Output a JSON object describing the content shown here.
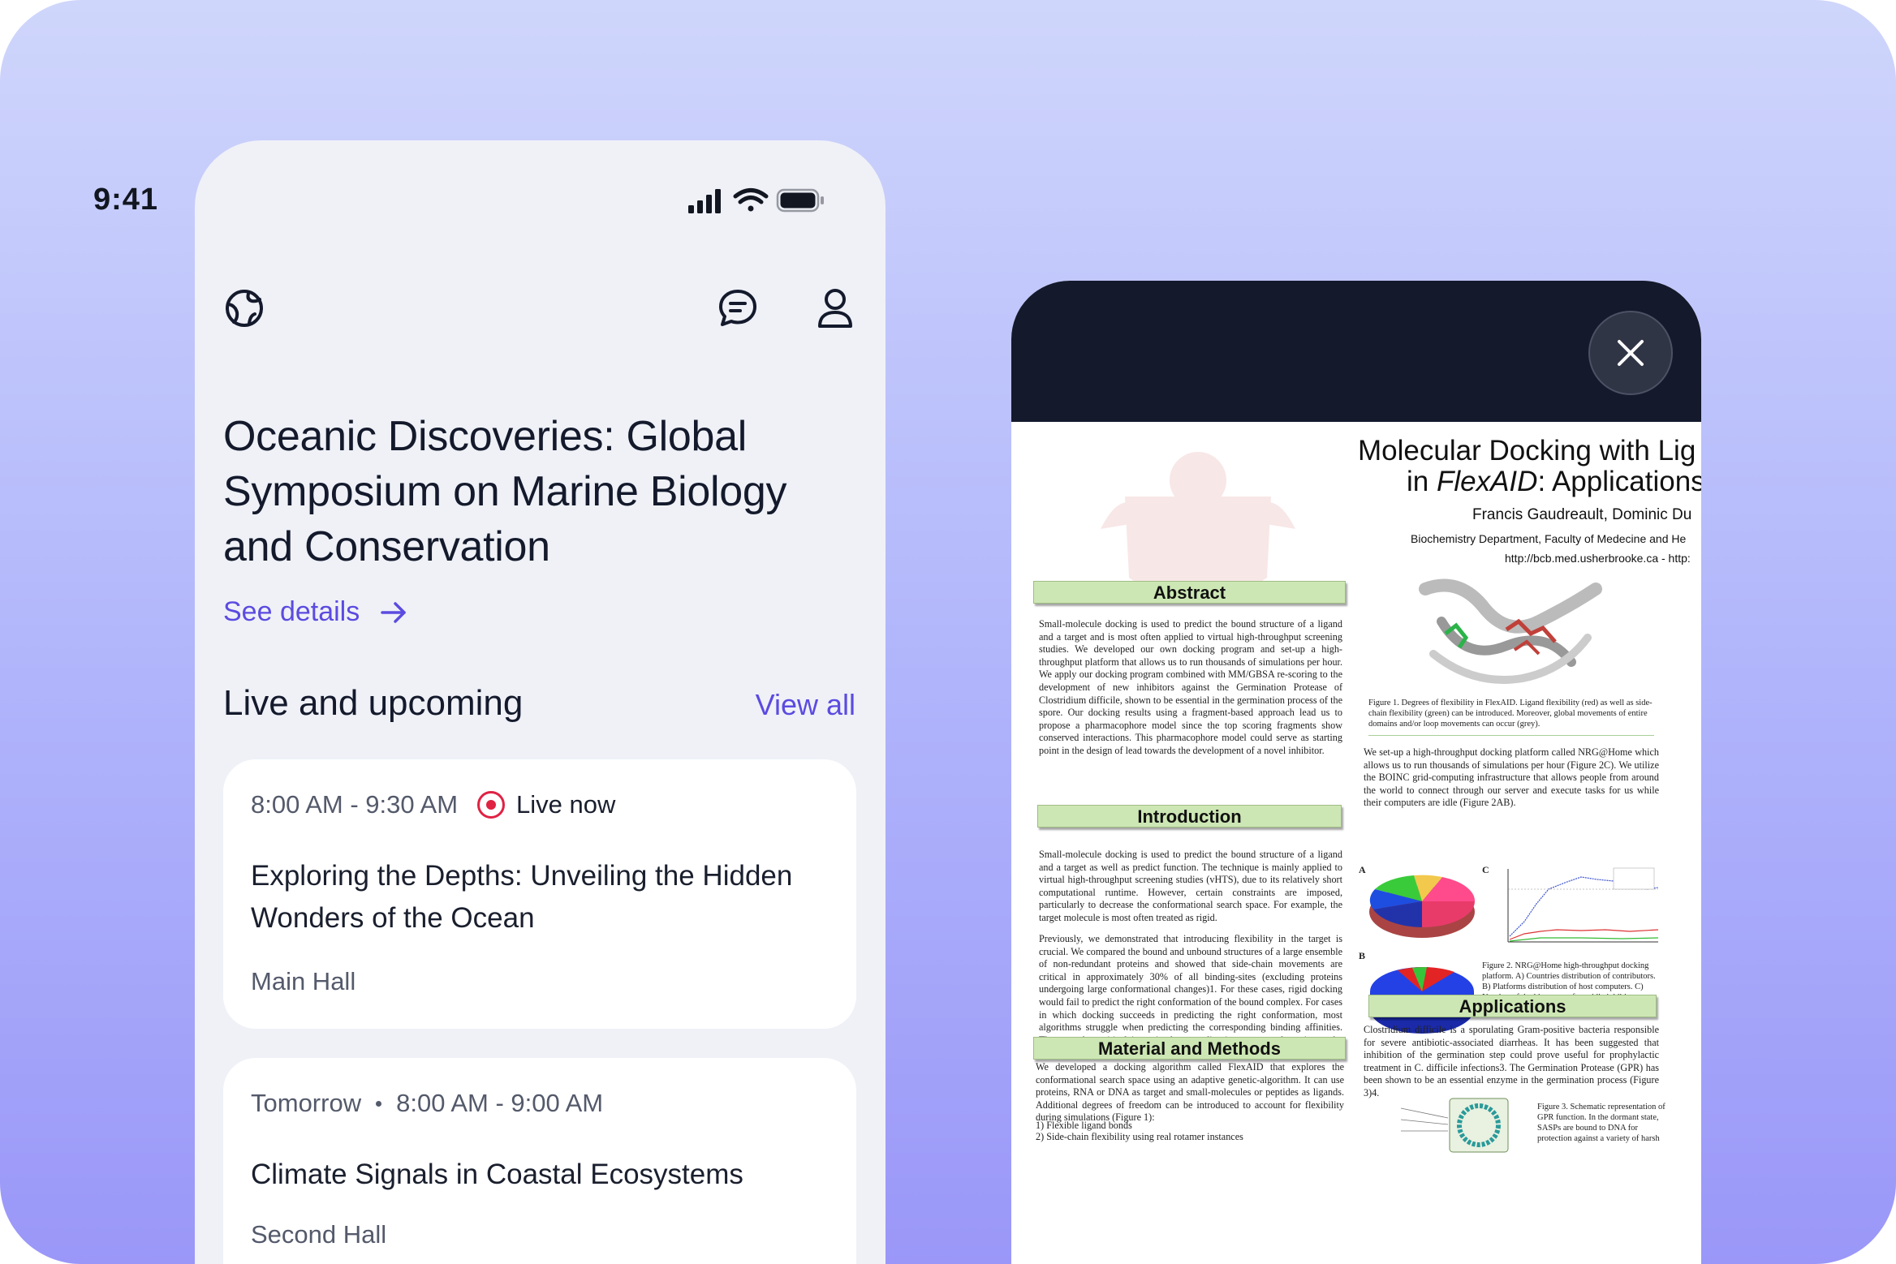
{
  "status_bar": {
    "time": "9:41"
  },
  "top_bar": {
    "left_icon": "globe-pin-icon",
    "right_icons": [
      "chat-icon",
      "user-icon"
    ]
  },
  "event": {
    "title": "Oceanic Discoveries: Global Symposium on Marine Biology and Conservation",
    "see_details": "See details"
  },
  "sessions_section": {
    "title": "Live and upcoming",
    "view_all": "View all",
    "sessions": [
      {
        "time": "8:00 AM - 9:30 AM",
        "live_label": "Live now",
        "title": "Exploring the Depths: Unveiling the Hidden Wonders of the Ocean",
        "location": "Main Hall"
      },
      {
        "day": "Tomorrow",
        "time": "8:00 AM - 9:00 AM",
        "title": "Climate Signals in Coastal Ecosystems",
        "location": "Second Hall"
      }
    ]
  },
  "poster_viewer": {
    "close_icon": "close-icon",
    "poster": {
      "title_line1": "Molecular Docking with Lig",
      "title_line2_prefix": "in ",
      "title_line2_italic": "FlexAID",
      "title_line2_suffix": ": Applications",
      "authors": "Francis Gaudreault, Dominic Du",
      "affiliation": "Biochemistry Department, Faculty of Medecine and He",
      "url": "http://bcb.med.usherbrooke.ca - http:",
      "abstract_heading": "Abstract",
      "abstract_text": "Small-molecule docking is used to predict the bound structure of a ligand and a target and is most often applied to virtual high-throughput screening studies. We developed our own docking program and set-up a high-throughput platform that allows us to run thousands of simulations per hour. We apply our docking program combined with MM/GBSA re-scoring to the development of new inhibitors against the Germination Protease of Clostridium difficile, shown to be essential in the germination process of the spore. Our docking results using a fragment-based approach lead us to propose a pharmacophore model since the top scoring fragments show conserved interactions. This pharmacophore model could serve as starting point in the design of lead towards the development of a novel inhibitor.",
      "introduction_heading": "Introduction",
      "introduction_text_1": "Small-molecule docking is used to predict the bound structure of a ligand and a target as well as predict function. The technique is mainly applied to virtual high-throughput screening studies (vHTS), due to its relatively short computational runtime. However, certain constraints are imposed, particularly to decrease the conformational search space. For example, the target molecule is most often treated as rigid.",
      "introduction_text_2": "Previously, we demonstrated that introducing flexibility in the target is crucial. We compared the bound and unbound structures of a large ensemble of non-redundant proteins and showed that side-chain movements are critical in approximately 30% of all binding-sites (excluding proteins undergoing large conformational changes)1. For these cases, rigid docking would fail to predict the right conformation of the bound complex. For cases in which docking succeeds in predicting the right conformation, most algorithms struggle when predicting the corresponding binding affinities. Thus, another critical issue in those studies is to accurately estimate the binding affinities of docking poses.",
      "methods_heading": "Material and Methods",
      "methods_text": "We developed a docking algorithm called FlexAID that explores the conformational search space using an adaptive genetic-algorithm. It can use proteins, RNA or DNA as target and small-molecules or peptides as ligands. Additional degrees of freedom can be introduced to account for flexibility during simulations (Figure 1):",
      "methods_list_1": "1) Flexible ligand bonds",
      "methods_list_2": "2) Side-chain flexibility using real rotamer instances",
      "figure1_caption": "Figure 1. Degrees of flexibility in FlexAID. Ligand flexibility (red) as well as side-chain flexibility (green) can be introduced. Moreover, global movements of entire domains and/or loop movements can occur (grey).",
      "platform_text": "We set-up a high-throughput docking platform called NRG@Home which allows us to run thousands of simulations per hour (Figure 2C). We utilize the BOINC grid-computing infrastructure that allows people from around the world to connect through our server and execute tasks for us while their computers are idle (Figure 2AB).",
      "figure2_caption": "Figure 2. NRG@Home high-throughput docking platform. A) Countries distribution of contributors. B) Platforms distribution of host computers. C) Number of docking runs of peptidic inhibitors against Matriptase over time.",
      "fig_label_a": "A",
      "fig_label_b": "B",
      "fig_label_c": "C",
      "applications_heading": "Applications",
      "applications_text": "Clostridium difficile is a sporulating Gram-positive bacteria responsible for severe antibiotic-associated diarrheas. It has been suggested that inhibition of the germination step could prove useful for prophylactic treatment in C. difficile infections3. The Germination Protease (GPR) has been shown to be an essential enzyme in the germination process (Figure 3)4.",
      "figure3_caption": "Figure 3. Schematic representation of GPR function. In the dormant state, SASPs are bound to DNA for protection against a variety of harsh"
    }
  },
  "colors": {
    "accent": "#5b4be0",
    "live": "#e02243",
    "viewer_header": "#141a2c",
    "poster_section": "#cde7b4"
  }
}
